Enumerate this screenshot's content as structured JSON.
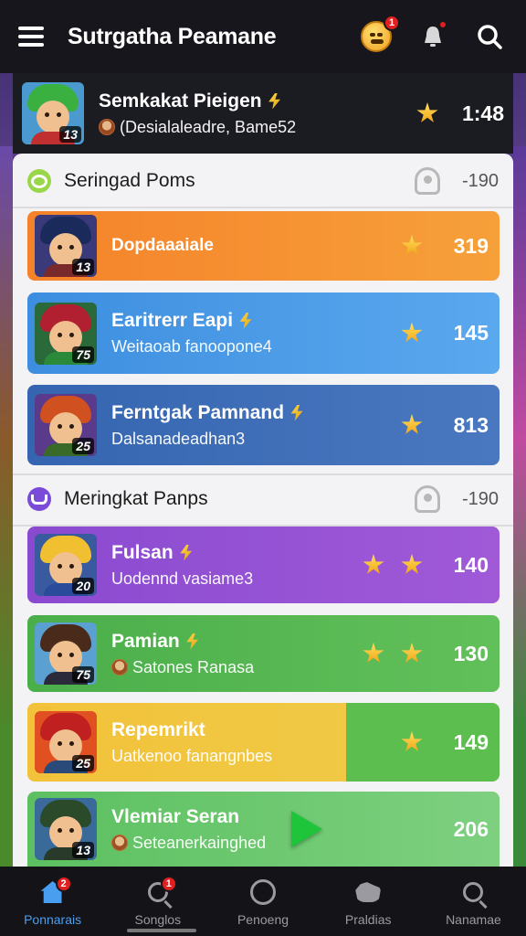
{
  "header": {
    "title": "Sutrgatha Peamane",
    "emoji_badge": "1",
    "icons": [
      "menu-icon",
      "emoji-face-icon",
      "bell-icon",
      "search-icon"
    ]
  },
  "featured": {
    "name": "Semkakat Pieigen",
    "subtitle": "(Desialaleadre, Bame52",
    "level": "13",
    "score": "1:48"
  },
  "sections": [
    {
      "title": "Seringad Poms",
      "count": "-190",
      "rows": [
        {
          "name": "Dopdaaaiale",
          "subtitle": "",
          "level": "13",
          "score": "319",
          "color": "#f5822a"
        },
        {
          "name": "Earitrerr Eapi",
          "subtitle": "Weitaoab fanoopone4",
          "level": "75",
          "score": "145",
          "color": "#3d8ee0"
        },
        {
          "name": "Ferntgak Pamnand",
          "subtitle": "Dalsanadeadhan3",
          "level": "25",
          "score": "813",
          "color": "#3565b0"
        }
      ]
    },
    {
      "title": "Meringkat Panps",
      "count": "-190",
      "rows": [
        {
          "name": "Fulsan",
          "subtitle": "Uodennd vasiame3",
          "level": "20",
          "score": "140",
          "color": "#8a4ad0"
        },
        {
          "name": "Pamian",
          "subtitle": "Satones Ranasa",
          "level": "75",
          "score": "130",
          "color": "#4aae4a"
        },
        {
          "name": "Repemrikt",
          "subtitle": "Uatkenoo fanangnbes",
          "level": "25",
          "score": "149",
          "color": "#f2c23a"
        },
        {
          "name": "Vlemiar Seran",
          "subtitle": "Seteanerkainghed",
          "level": "13",
          "score": "206",
          "color": "#5cc060"
        }
      ]
    }
  ],
  "nav": {
    "items": [
      {
        "label": "Ponnarais",
        "icon": "home-icon",
        "badge": "2"
      },
      {
        "label": "Songlos",
        "icon": "search-icon",
        "badge": "1"
      },
      {
        "label": "Penoeng",
        "icon": "circle-icon"
      },
      {
        "label": "Praldias",
        "icon": "paw-icon"
      },
      {
        "label": "Nanamae",
        "icon": "search-icon"
      }
    ]
  }
}
